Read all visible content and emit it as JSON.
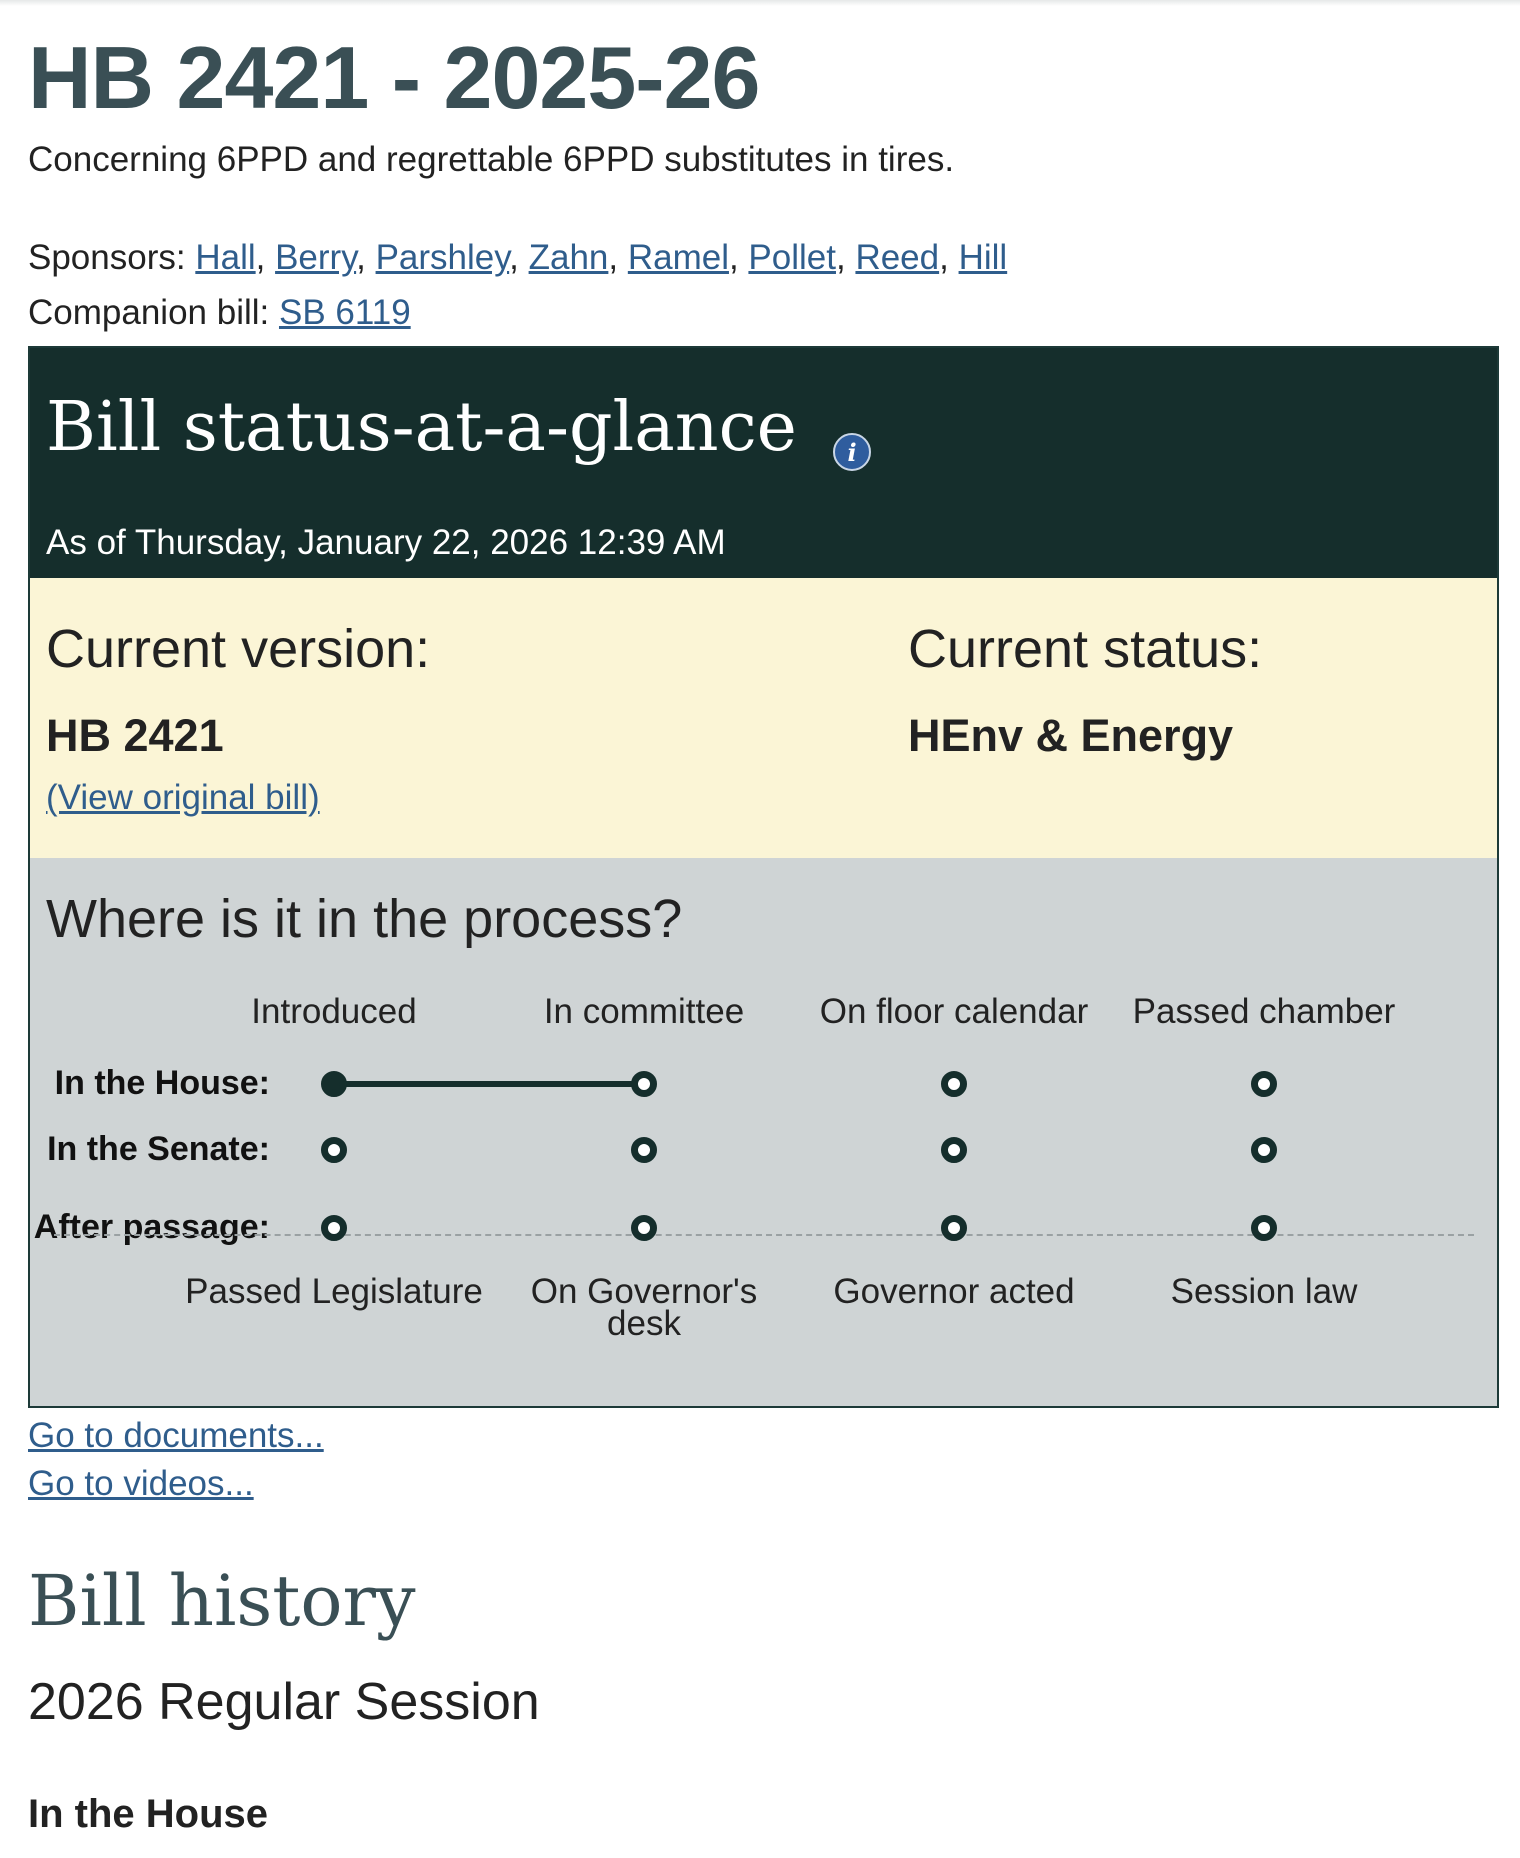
{
  "bill": {
    "title": "HB 2421 - 2025-26",
    "description": "Concerning 6PPD and regrettable 6PPD substitutes in tires.",
    "sponsors_label": "Sponsors:",
    "sponsors": [
      "Hall",
      "Berry",
      "Parshley",
      "Zahn",
      "Ramel",
      "Pollet",
      "Reed",
      "Hill"
    ],
    "companion_label": "Companion bill:",
    "companion_bill": "SB 6119"
  },
  "status": {
    "heading": "Bill status-at-a-glance",
    "info_icon": "i",
    "as_of": "As of Thursday, January 22, 2026 12:39 AM",
    "current_version_label": "Current version:",
    "current_version": "HB 2421",
    "view_original": "(View original bill)",
    "current_status_label": "Current status:",
    "current_status": "HEnv & Energy"
  },
  "process": {
    "heading": "Where is it in the process?",
    "top_stages": [
      "Introduced",
      "In committee",
      "On floor calendar",
      "Passed chamber"
    ],
    "house_label": "In the House:",
    "senate_label": "In the Senate:",
    "after_label": "After passage:",
    "house_progress_stage": 2,
    "bottom_stages": [
      "Passed Legislature",
      "On Governor's desk",
      "Governor acted",
      "Session law"
    ]
  },
  "links": {
    "documents": "Go to documents...",
    "videos": "Go to videos..."
  },
  "history": {
    "heading": "Bill history",
    "session": "2026 Regular Session",
    "chamber": "In the House"
  }
}
